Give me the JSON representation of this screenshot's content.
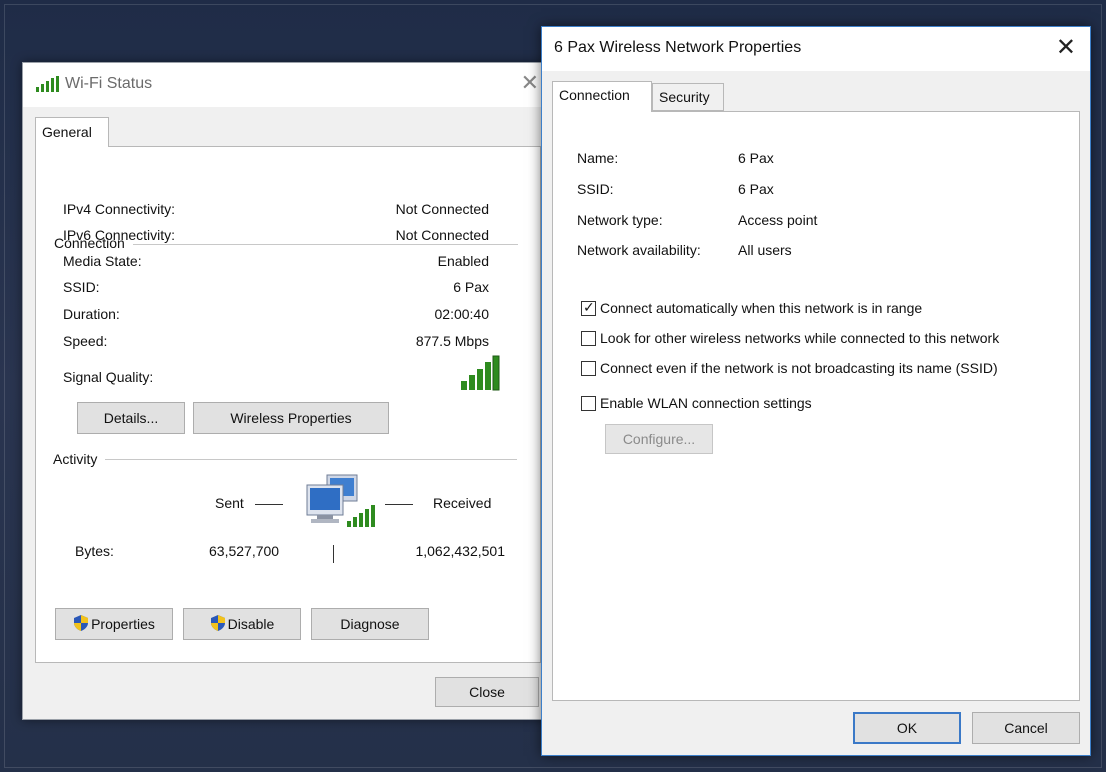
{
  "wifi_status": {
    "title": "Wi-Fi Status",
    "close_glyph": "✕",
    "tab": "General",
    "connection_label": "Connection",
    "rows": [
      {
        "label": "IPv4 Connectivity:",
        "value": "Not Connected"
      },
      {
        "label": "IPv6 Connectivity:",
        "value": "Not Connected"
      },
      {
        "label": "Media State:",
        "value": "Enabled"
      },
      {
        "label": "SSID:",
        "value": "6 Pax"
      },
      {
        "label": "Duration:",
        "value": "02:00:40"
      },
      {
        "label": "Speed:",
        "value": "877.5 Mbps"
      }
    ],
    "signal_label": "Signal Quality:",
    "details_button": "Details...",
    "wireless_props_button": "Wireless Properties",
    "activity_label": "Activity",
    "sent_label": "Sent",
    "received_label": "Received",
    "bytes_label": "Bytes:",
    "bytes_sent": "63,527,700",
    "bytes_received": "1,062,432,501",
    "properties_button": "Properties",
    "disable_button": "Disable",
    "diagnose_button": "Diagnose",
    "close_button": "Close"
  },
  "network_properties": {
    "title": "6 Pax Wireless Network Properties",
    "close_glyph": "✕",
    "tabs": [
      "Connection",
      "Security"
    ],
    "info": [
      {
        "label": "Name:",
        "value": "6 Pax"
      },
      {
        "label": "SSID:",
        "value": "6 Pax"
      },
      {
        "label": "Network type:",
        "value": "Access point"
      },
      {
        "label": "Network availability:",
        "value": "All users"
      }
    ],
    "checkboxes": [
      {
        "label": "Connect automatically when this network is in range",
        "checked": true
      },
      {
        "label": "Look for other wireless networks while connected to this network",
        "checked": false
      },
      {
        "label": "Connect even if the network is not broadcasting its name (SSID)",
        "checked": false
      },
      {
        "label": "Enable WLAN connection settings",
        "checked": false
      }
    ],
    "configure_button": "Configure...",
    "ok_button": "OK",
    "cancel_button": "Cancel"
  },
  "colors": {
    "signal_green": "#2e8b1f",
    "accent_blue": "#3b79c7",
    "shield_blue": "#2a58b8",
    "shield_yellow": "#f2c21b"
  },
  "icons": [
    "wifi-signal-icon",
    "close-icon",
    "network-computers-icon",
    "uac-shield-icon",
    "checkmark-icon"
  ]
}
